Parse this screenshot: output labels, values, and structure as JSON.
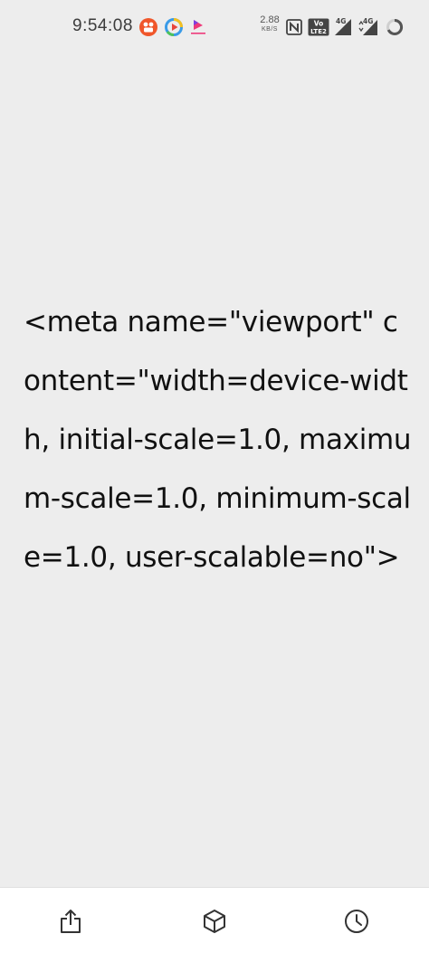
{
  "status_bar": {
    "time": "9:54:08",
    "net_speed_value": "2.88",
    "net_speed_unit": "KB/S",
    "volte_label": "Vo LTE 2",
    "signal1_label": "4G",
    "signal2_label": "4G",
    "notification_icons": [
      "orange-app-icon",
      "play-app-icon",
      "pink-app-icon"
    ]
  },
  "content": {
    "code": "<meta name=\"viewport\" content=\"width=device-width, initial-scale=1.0, maximum-scale=1.0, minimum-scale=1.0, user-scalable=no\">"
  },
  "toolbar": {
    "items": [
      "share-icon",
      "box-icon",
      "history-icon"
    ]
  },
  "colors": {
    "background": "#ededed",
    "text": "#111111",
    "toolbar_bg": "#ffffff",
    "icon": "#333333",
    "notif_orange": "#f0562a"
  }
}
